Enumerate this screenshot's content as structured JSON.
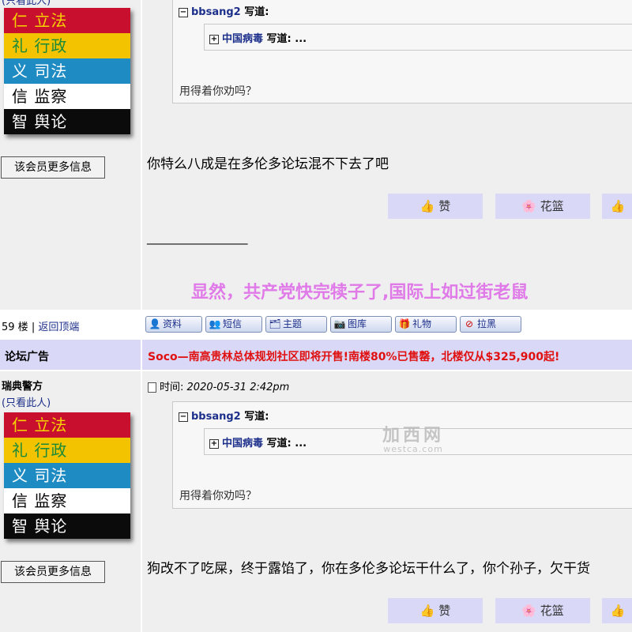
{
  "badge": {
    "rows": [
      {
        "text": "仁 立法",
        "bg": "#c8102e",
        "fg": "#f6d300"
      },
      {
        "text": "礼 行政",
        "bg": "#f3c300",
        "fg": "#1a8a3a"
      },
      {
        "text": "义 司法",
        "bg": "#1e8bc3",
        "fg": "#ffffff"
      },
      {
        "text": "信 监察",
        "bg": "#ffffff",
        "fg": "#000000"
      },
      {
        "text": "智 舆论",
        "bg": "#0b0b0b",
        "fg": "#ffffff"
      }
    ]
  },
  "top_user": {
    "view_only": "(只看此人)"
  },
  "more_info_label": "该会员更多信息",
  "post1": {
    "quote_outer_user": "bbsang2",
    "quote_says": "写道:",
    "quote_inner_user": "中国病毒",
    "quote_inner_says": "写道: ...",
    "quote_text": "用得着你劝吗？",
    "body": "你特么八成是在多伦多论坛混不下去了吧",
    "signature_line": "_________________",
    "signature": "显然，共产党快完犊子了,国际上如过街老鼠"
  },
  "reactions": {
    "like": "赞",
    "flowers": "花篮"
  },
  "floor_bar": {
    "floor": "59 楼",
    "sep": "|",
    "back_top": "返回顶端"
  },
  "tools": [
    {
      "label": "资料",
      "icon": "person-icon"
    },
    {
      "label": "短信",
      "icon": "message-icon"
    },
    {
      "label": "主题",
      "icon": "topic-icon"
    },
    {
      "label": "图库",
      "icon": "camera-icon"
    },
    {
      "label": "礼物",
      "icon": "gift-icon"
    },
    {
      "label": "拉黑",
      "icon": "block-icon"
    }
  ],
  "ad": {
    "label": "论坛广告",
    "text": "Soco—南高贵林总体规划社区即将开售!南楼80%已售罄，北楼仅从$325,900起!"
  },
  "post2": {
    "username": "瑞典警方",
    "view_only": "(只看此人)",
    "time_label": "时间:",
    "time_value": "2020-05-31 2:42pm",
    "quote_outer_user": "bbsang2",
    "quote_says": "写道:",
    "quote_inner_user": "中国病毒",
    "quote_inner_says": "写道: ...",
    "quote_text": "用得着你劝吗？",
    "body": "狗改不了吃屎，终于露馅了，你在多伦多论坛干什么了，你个孙子，欠干货"
  },
  "watermark": {
    "cn": "加西网",
    "en": "westca.com"
  }
}
